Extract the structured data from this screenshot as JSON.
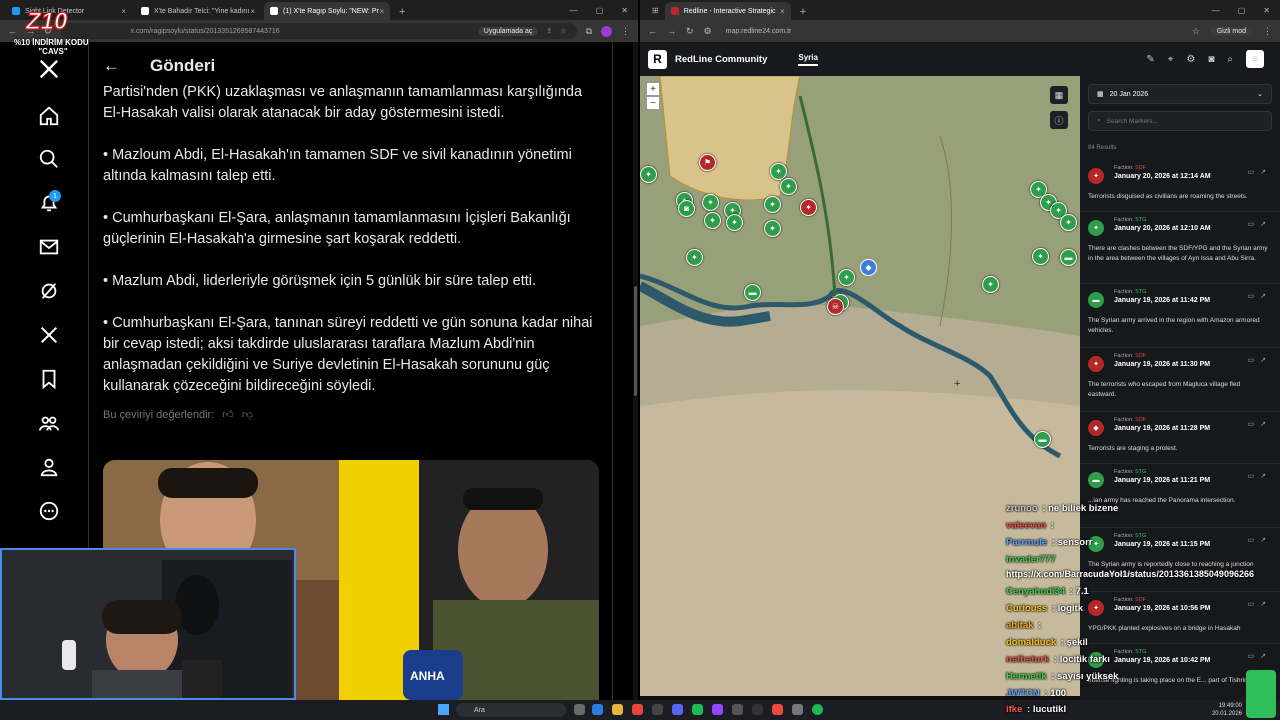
{
  "left_browser": {
    "tabs": [
      {
        "title": "Sight Link Detector"
      },
      {
        "title": "X'te Bahadır Telci: \"Yine kadını"
      },
      {
        "title": "(1) X'te Ragıp Soylu: \"NEW: Pr"
      }
    ],
    "url": "x.com/ragipsoylu/status/2013351269587443716",
    "app_pill": "Uygulamada aç"
  },
  "logo": {
    "line1": "%10 İNDİRİM KODU",
    "line2": "\"CAVS\""
  },
  "x_sidebar": {
    "notification_count": "1"
  },
  "tweet": {
    "header": "Gönderi",
    "paragraphs": [
      "Partisi'nden (PKK) uzaklaşması ve anlaşmanın tamamlanması karşılığında El-Hasakah valisi olarak atanacak bir aday göstermesini istedi.",
      "• Mazloum Abdi, El-Hasakah'ın tamamen SDF ve sivil kanadının yönetimi altında kalmasını talep etti.",
      "• Cumhurbaşkanı El-Şara, anlaşmanın tamamlanmasını İçişleri Bakanlığı güçlerinin El-Hasakah'a girmesine şart koşarak reddetti.",
      "• Mazlum Abdi, liderleriyle görüşmek için 5 günlük bir süre talep etti.",
      "• Cumhurbaşkanı El-Şara, tanınan süreyi reddetti ve gün sonuna kadar nihai bir cevap istedi; aksi takdirde uluslararası taraflara Mazlum Abdi'nin anlaşmadan çekildiğini ve Suriye devletinin El-Hasakah sorununu güç kullanarak çözeceğini bildireceğini söyledi."
    ],
    "rate_translation": "Bu çeviriyi değerlendir:",
    "photo_mic_label": "ANHA"
  },
  "right_browser": {
    "tab_title": "Redline - Interactive Strategic",
    "url": "map.redline24.com.tr",
    "incognito": "Gizli mod"
  },
  "redline": {
    "brand": "RedLine Community",
    "tab": "Syria",
    "date": "20 Jan 2026",
    "search_placeholder": "Search Markers...",
    "results": "84 Results",
    "events": [
      {
        "faction": "SDF",
        "date": "January 20, 2026 at 12:14 AM",
        "text": "Terrorists disguised as civilians are roaming the streets.",
        "color": "#b42828"
      },
      {
        "faction": "STG",
        "date": "January 20, 2026 at 12:10 AM",
        "text": "There are clashes between the SDF/YPG and the Syrian army in the area between the villages of Ayn Issa and Abu Sirra.",
        "color": "#2f9e4a"
      },
      {
        "faction": "STG",
        "date": "January 19, 2026 at 11:42 PM",
        "text": "The Syrian army arrived in the region with Amazon armored vehicles.",
        "color": "#2f9e4a"
      },
      {
        "faction": "SDF",
        "date": "January 19, 2026 at 11:30 PM",
        "text": "The terrorists who escaped from Magluca village fled eastward.",
        "color": "#b42828"
      },
      {
        "faction": "SDF",
        "date": "January 19, 2026 at 11:28 PM",
        "text": "Terrorists are staging a protest.",
        "color": "#b42828"
      },
      {
        "faction": "STG",
        "date": "January 19, 2026 at 11:21 PM",
        "text": "...ian army has reached the Panorama intersection.",
        "color": "#2f9e4a"
      },
      {
        "faction": "STG",
        "date": "January 19, 2026 at 11:15 PM",
        "text": "The Syrian army is reportedly close to reaching a junction south of Hasakah.",
        "color": "#2f9e4a"
      },
      {
        "faction": "SDF",
        "date": "January 19, 2026 at 10:56 PM",
        "text": "YPG/PKK planted explosives on a bridge in Hasakah",
        "color": "#b42828"
      },
      {
        "faction": "STG",
        "date": "January 19, 2026 at 10:42 PM",
        "text": "Intense fighting is taking place on the E... part of Tishrin.",
        "color": "#2f9e4a"
      }
    ]
  },
  "chat": [
    {
      "user": "zrunoo",
      "msg": "ne biliek bizene",
      "color": "#c9c9c9"
    },
    {
      "user": "valeevan",
      "msg": "",
      "color": "#e05050"
    },
    {
      "user": "Parrmule",
      "msg": "sensorr",
      "color": "#5aa0ff"
    },
    {
      "user": "invader777",
      "msg": "",
      "color": "#3fd14b"
    },
    {
      "user": "",
      "msg": "https://x.com/BarracudaYol1/status/2013361385049096266",
      "color": "#fff"
    },
    {
      "user": "Cenyahudi34",
      "msg": "7.1",
      "color": "#3fd14b"
    },
    {
      "user": "Curiouss",
      "msg": "logitk",
      "color": "#f0c020"
    },
    {
      "user": "abitak",
      "msg": "",
      "color": "#f0a020"
    },
    {
      "user": "domalduck",
      "msg": "şekil",
      "color": "#f0c020"
    },
    {
      "user": "nstheturk",
      "msg": "locitik farkı",
      "color": "#e05050"
    },
    {
      "user": "Hermetik",
      "msg": "sayısı yüksek",
      "color": "#3fd14b"
    },
    {
      "user": "JWTCN",
      "msg": "100",
      "color": "#5aa0ff"
    },
    {
      "user": "ifke",
      "msg": "lucutikl",
      "color": "#ff5050"
    }
  ],
  "taskbar": {
    "search": "Ara",
    "time": "19:49:00",
    "date": "20.01.2026"
  }
}
